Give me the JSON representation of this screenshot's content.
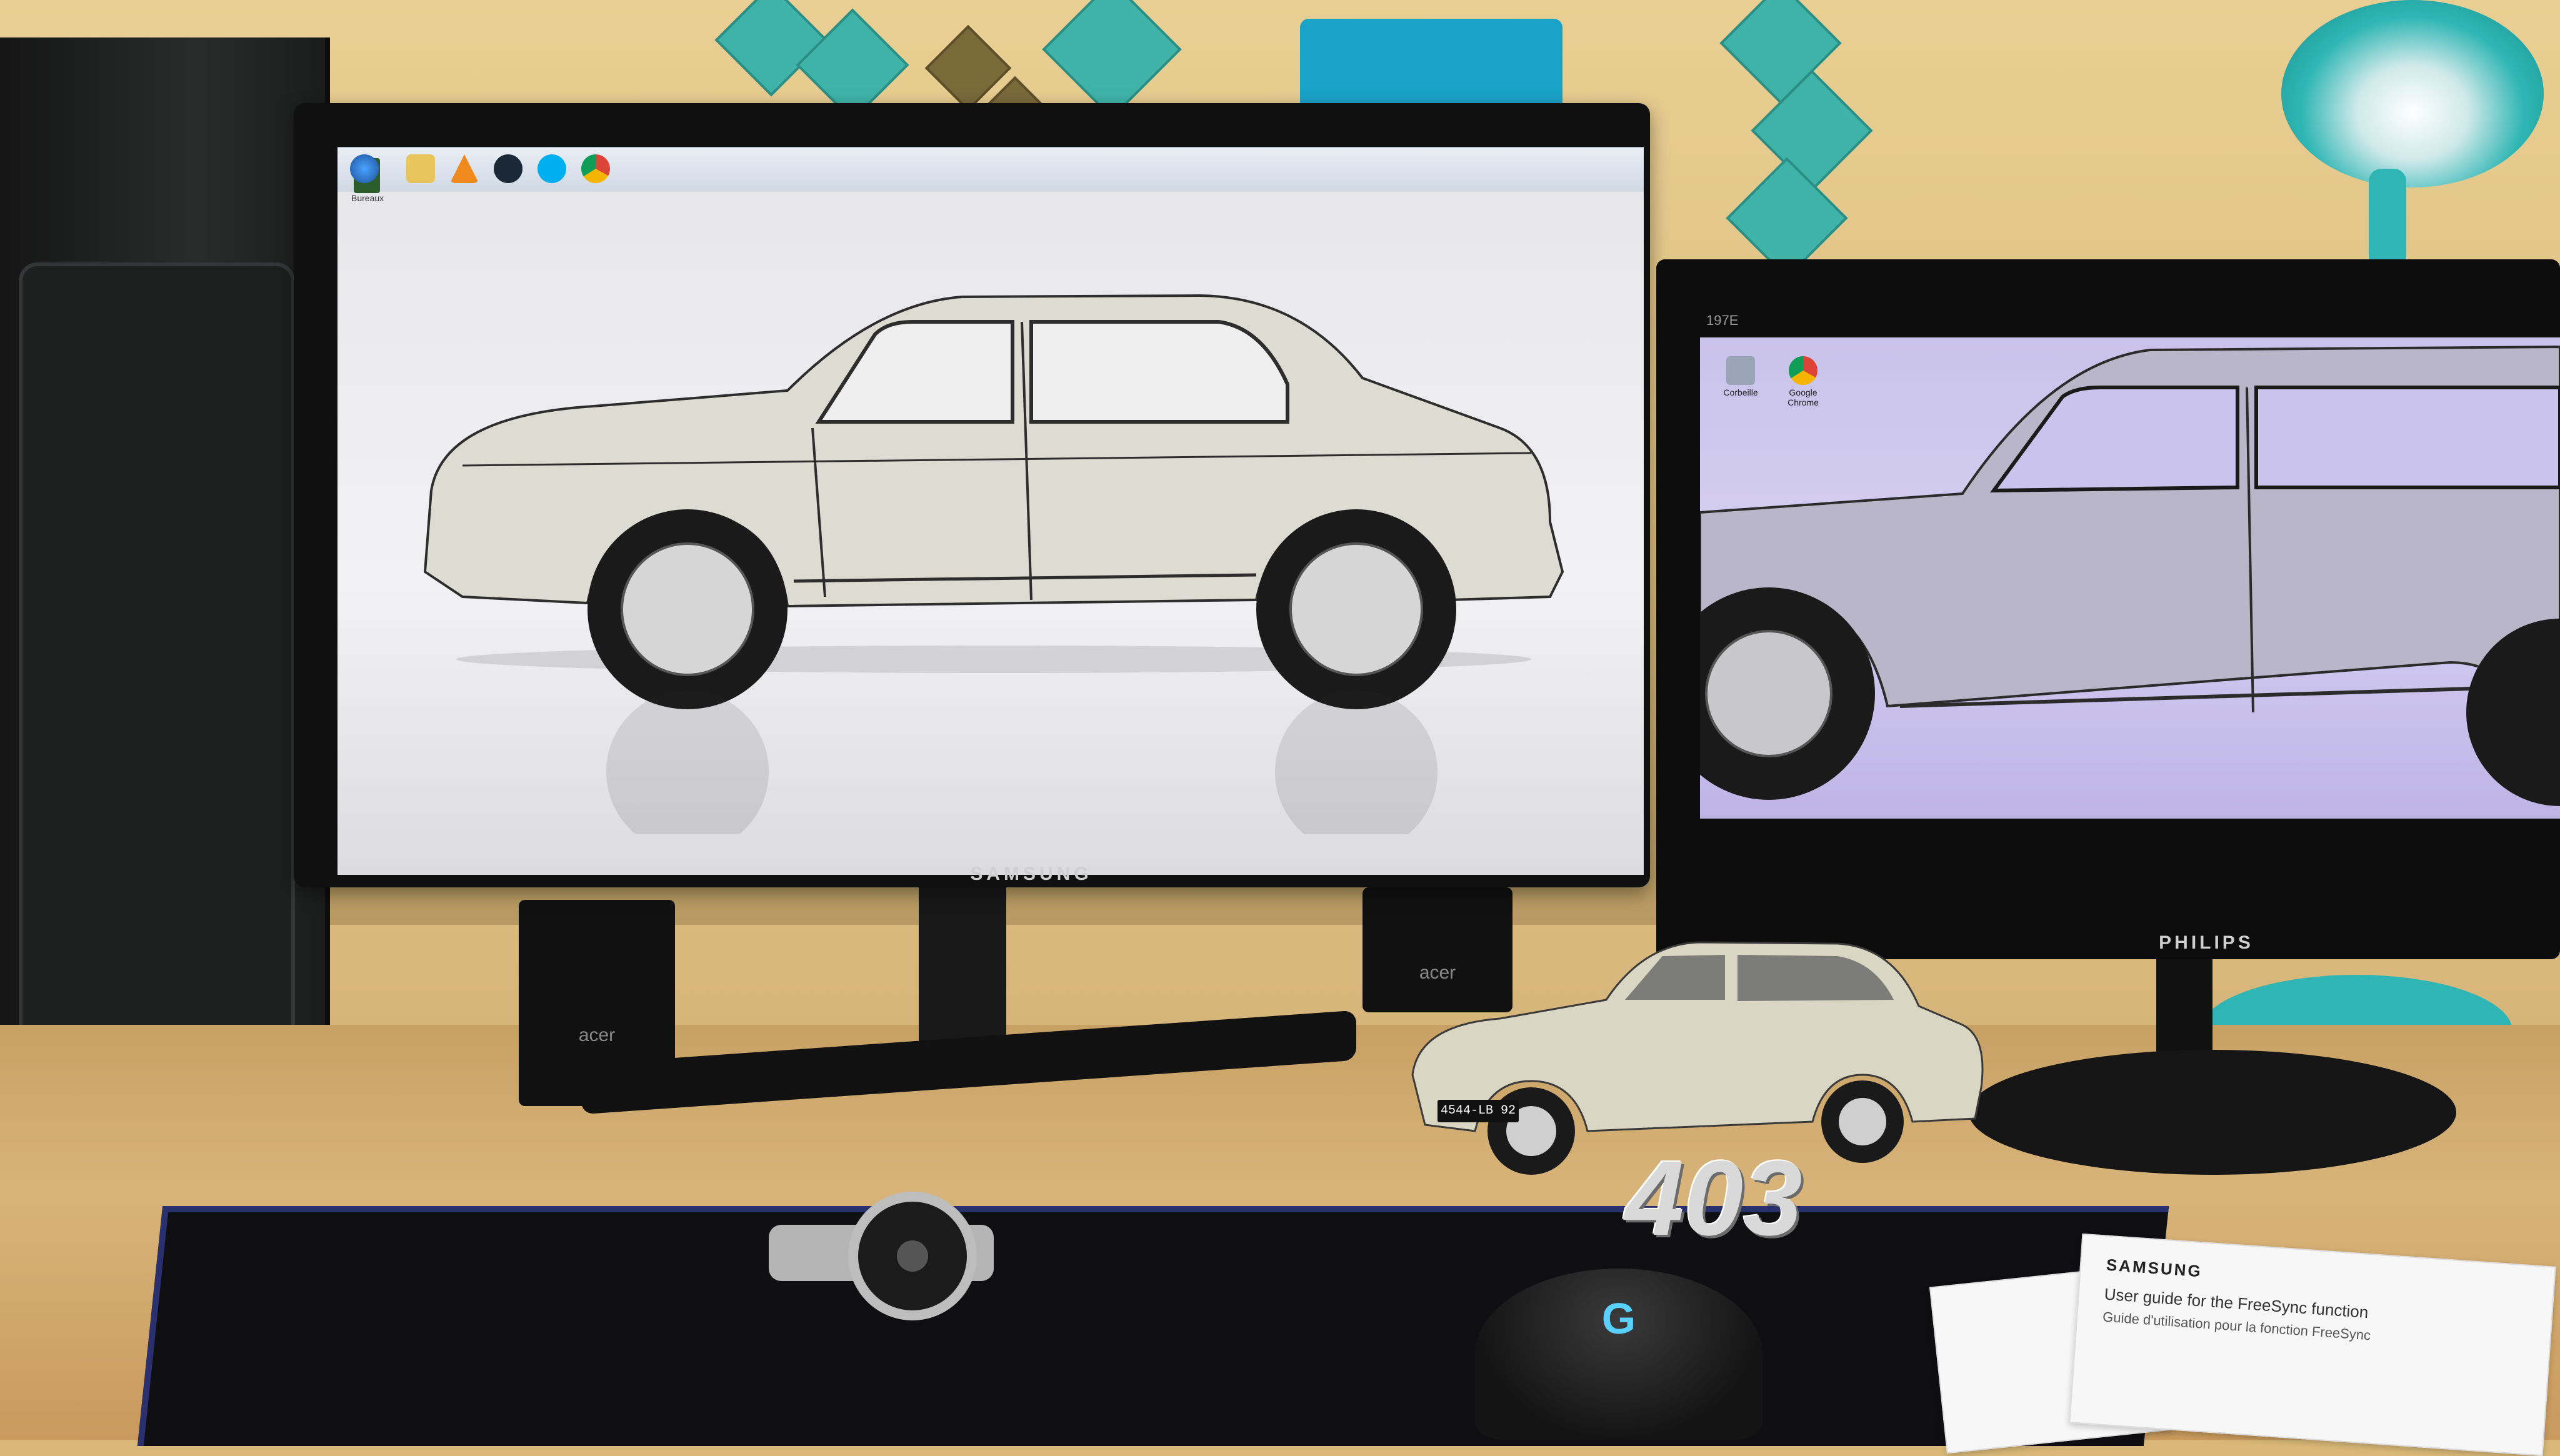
{
  "scene": {
    "description_tags": [
      "dual-monitor-desk",
      "windows-7-desktop"
    ]
  },
  "samsung_monitor": {
    "brand": "SAMSUNG",
    "desktop_icon_label": "Bureaux",
    "taskbar": {
      "icons": [
        "start-orb",
        "explorer",
        "vlc",
        "steam",
        "skype",
        "chrome"
      ]
    }
  },
  "philips_monitor": {
    "brand": "PHILIPS",
    "model_label": "197E",
    "desktop_icons": [
      {
        "label": "Corbeille",
        "icon": "recycle-bin-icon"
      },
      {
        "label": "Google Chrome",
        "icon": "chrome-icon"
      }
    ]
  },
  "speakers": {
    "left_brand": "acer",
    "right_brand": "acer"
  },
  "model_car": {
    "plate": "4544-LB 92",
    "emblem": "403"
  },
  "manual": {
    "brand": "SAMSUNG",
    "title_en": "User guide for the FreeSync function",
    "title_fr": "Guide d'utilisation pour la fonction FreeSync"
  },
  "mouse": {
    "logo": "G"
  },
  "colors": {
    "wall": "#e3c688",
    "desk": "#d2a86b",
    "accent_teal": "#2fb6b4",
    "screen_tint_philips": "#cbc3ec"
  }
}
